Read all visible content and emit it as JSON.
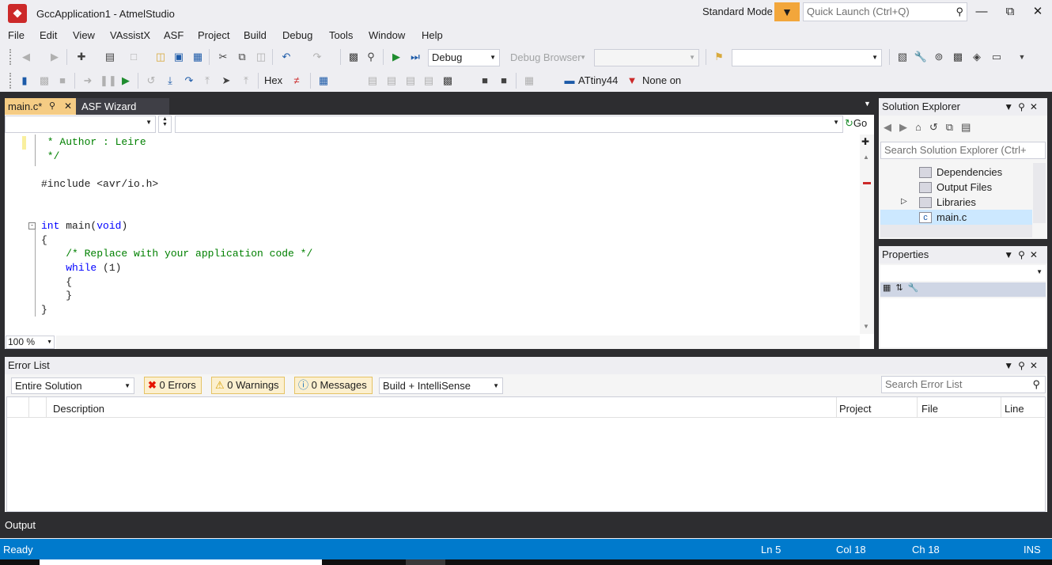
{
  "window": {
    "title": "GccApplication1 - AtmelStudio",
    "mode": "Standard Mode",
    "quick_launch_placeholder": "Quick Launch (Ctrl+Q)"
  },
  "menu": [
    "File",
    "Edit",
    "View",
    "VAssistX",
    "ASF",
    "Project",
    "Build",
    "Debug",
    "Tools",
    "Window",
    "Help"
  ],
  "toolbar": {
    "config": "Debug",
    "debug_browser": "Debug Browser",
    "hex_label": "Hex",
    "device": "ATtiny44",
    "tool": "None on"
  },
  "editor": {
    "tabs": [
      {
        "label": "main.c*"
      },
      {
        "label": "ASF Wizard"
      }
    ],
    "go_label": "Go",
    "zoom": "100 %",
    "code_lines": [
      {
        "text": " * Author : Leire",
        "kind": "comment"
      },
      {
        "text": " */",
        "kind": "comment"
      },
      {
        "text": "",
        "kind": "plain"
      },
      {
        "text": "#include <avr/io.h>",
        "kind": "plain"
      },
      {
        "text": "",
        "kind": "plain"
      },
      {
        "text": "",
        "kind": "plain"
      },
      {
        "text": "int main(void)",
        "kind": "plain"
      },
      {
        "text": "{",
        "kind": "plain"
      },
      {
        "text": "    /* Replace with your application code */",
        "kind": "comment"
      },
      {
        "text": "    while (1)",
        "kind": "plain"
      },
      {
        "text": "    {",
        "kind": "plain"
      },
      {
        "text": "    }",
        "kind": "plain"
      },
      {
        "text": "}",
        "kind": "plain"
      }
    ]
  },
  "solution_explorer": {
    "title": "Solution Explorer",
    "search_placeholder": "Search Solution Explorer (Ctrl+",
    "items": [
      {
        "label": "Dependencies"
      },
      {
        "label": "Output Files"
      },
      {
        "label": "Libraries"
      },
      {
        "label": "main.c"
      }
    ]
  },
  "properties": {
    "title": "Properties"
  },
  "error_list": {
    "title": "Error List",
    "scope": "Entire Solution",
    "errors": "0 Errors",
    "warnings": "0 Warnings",
    "messages": "0 Messages",
    "source": "Build + IntelliSense",
    "search_placeholder": "Search Error List",
    "columns": {
      "description": "Description",
      "project": "Project",
      "file": "File",
      "line": "Line"
    }
  },
  "output_tab": "Output",
  "status": {
    "ready": "Ready",
    "ln": "Ln 5",
    "col": "Col 18",
    "ch": "Ch 18",
    "ins": "INS"
  },
  "colors": {
    "status_bar": "#007acc",
    "active_tab": "#f5cc84",
    "keyword": "#0000ff",
    "comment": "#008000"
  }
}
